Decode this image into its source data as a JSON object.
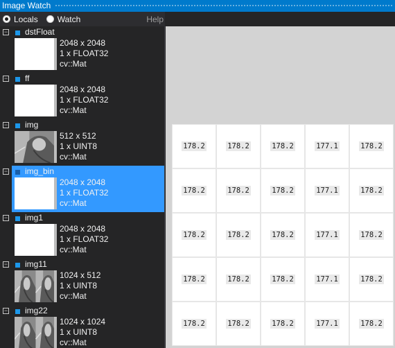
{
  "window": {
    "title": "Image Watch"
  },
  "toolbar": {
    "modes": [
      {
        "label": "Locals",
        "selected": true
      },
      {
        "label": "Watch",
        "selected": false
      }
    ],
    "help_label": "Help"
  },
  "variables": [
    {
      "name": "dstFloat",
      "size": "2048 x 2048",
      "format": "1 x FLOAT32",
      "type": "cv::Mat",
      "thumbnail": "blank"
    },
    {
      "name": "ff",
      "size": "2048 x 2048",
      "format": "1 x FLOAT32",
      "type": "cv::Mat",
      "thumbnail": "blank"
    },
    {
      "name": "img",
      "size": "512 x 512",
      "format": "1 x UINT8",
      "type": "cv::Mat",
      "thumbnail": "grayscale-photo"
    },
    {
      "name": "img_bin",
      "size": "2048 x 2048",
      "format": "1 x FLOAT32",
      "type": "cv::Mat",
      "thumbnail": "blank",
      "selected": true
    },
    {
      "name": "img1",
      "size": "2048 x 2048",
      "format": "1 x FLOAT32",
      "type": "cv::Mat",
      "thumbnail": "blank"
    },
    {
      "name": "img11",
      "size": "1024 x 512",
      "format": "1 x UINT8",
      "type": "cv::Mat",
      "thumbnail": "grayscale-photo-tiled"
    },
    {
      "name": "img22",
      "size": "1024 x 1024",
      "format": "1 x UINT8",
      "type": "cv::Mat",
      "thumbnail": "grayscale-photo-tiled"
    }
  ],
  "pixel_grid": {
    "rows": [
      [
        "178.2",
        "178.2",
        "178.2",
        "177.1",
        "178.2"
      ],
      [
        "178.2",
        "178.2",
        "178.2",
        "177.1",
        "178.2"
      ],
      [
        "178.2",
        "178.2",
        "178.2",
        "177.1",
        "178.2"
      ],
      [
        "178.2",
        "178.2",
        "178.2",
        "177.1",
        "178.2"
      ],
      [
        "178.2",
        "178.2",
        "178.2",
        "177.1",
        "178.2"
      ]
    ]
  },
  "colors": {
    "accent": "#007acc",
    "selection": "#3399ff",
    "panel": "#252526",
    "canvas_background": "#d3d3d3"
  }
}
